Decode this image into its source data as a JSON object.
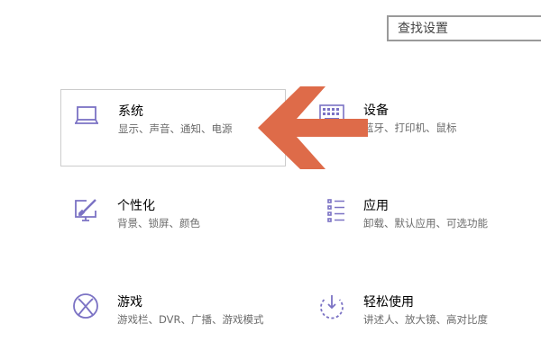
{
  "search": {
    "placeholder": "查找设置"
  },
  "tiles": [
    {
      "title": "系统",
      "desc": "显示、声音、通知、电源",
      "icon": "laptop-icon"
    },
    {
      "title": "设备",
      "desc": "蓝牙、打印机、鼠标",
      "icon": "keyboard-icon"
    },
    {
      "title": "个性化",
      "desc": "背景、锁屏、颜色",
      "icon": "personalization-icon"
    },
    {
      "title": "应用",
      "desc": "卸载、默认应用、可选功能",
      "icon": "apps-list-icon"
    },
    {
      "title": "游戏",
      "desc": "游戏栏、DVR、广播、游戏模式",
      "icon": "xbox-icon"
    },
    {
      "title": "轻松使用",
      "desc": "讲述人、放大镜、高对比度",
      "icon": "ease-of-access-icon"
    }
  ],
  "colors": {
    "accent": "#7b72c4",
    "arrow": "#de6b49",
    "selected_border": "#cccccc"
  }
}
